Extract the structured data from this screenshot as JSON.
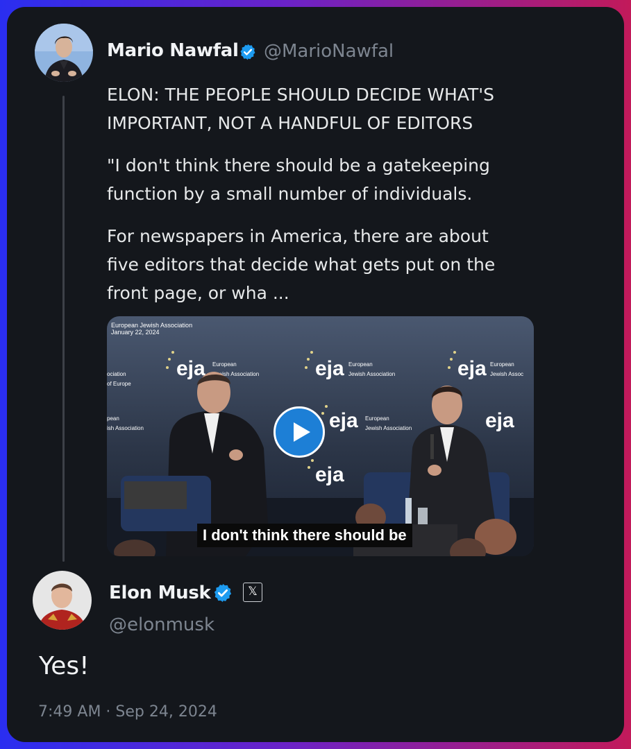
{
  "original_post": {
    "author_name": "Mario Nawfal",
    "author_handle": "@MarioNawfal",
    "avatar_icon": "mario-avatar",
    "verified_icon": "verified-badge-icon",
    "headline_line1": "ELON: THE PEOPLE SHOULD DECIDE WHAT'S",
    "headline_line2": "IMPORTANT, NOT A HANDFUL OF EDITORS",
    "quote_line1": "\"I don't think there should be a gatekeeping",
    "quote_line2": "function by a small number of individuals.",
    "body_line1": "For newspapers in America, there are about",
    "body_line2": "five editors that decide what gets put on the",
    "body_line3": "front page, or wha ...",
    "video": {
      "overlay_line1": "European Jewish Association",
      "overlay_line2": "January 22, 2024",
      "caption": "I don't think there should be",
      "play_icon": "play-icon"
    }
  },
  "reply": {
    "author_name": "Elon Musk",
    "author_handle": "@elonmusk",
    "avatar_icon": "elon-avatar",
    "verified_icon": "verified-badge-icon",
    "affiliate_icon": "x-logo-icon",
    "affiliate_glyph": "𝕏",
    "text": "Yes!",
    "timestamp": "7:49 AM · Sep 24, 2024"
  },
  "colors": {
    "card_bg": "#14171c",
    "verified_blue": "#1d9bf0",
    "text_primary": "#e7e9ea",
    "text_secondary": "#7d8590"
  }
}
